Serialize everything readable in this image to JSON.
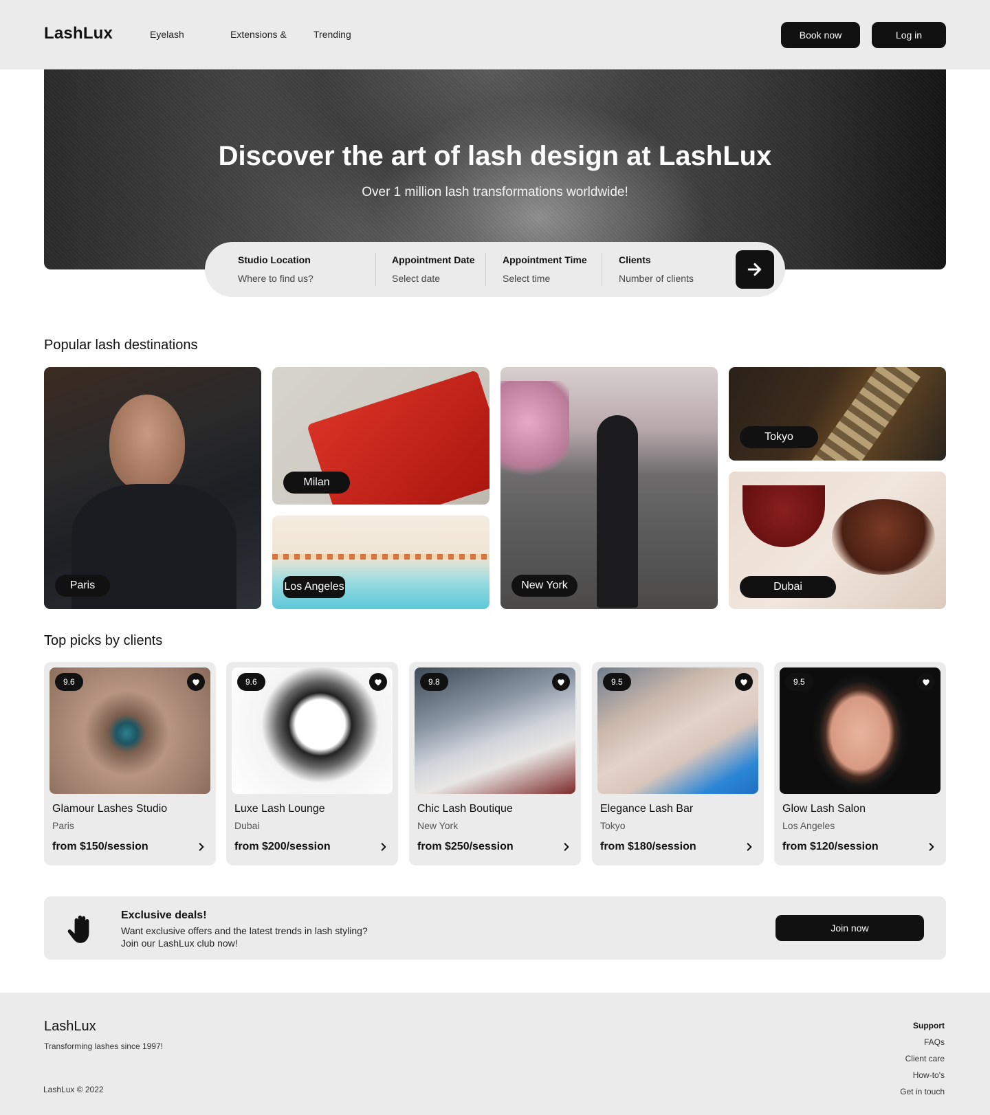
{
  "header": {
    "logo": "LashLux",
    "nav": [
      "Eyelash",
      "Extensions &",
      "Trending"
    ],
    "book_label": "Book now",
    "login_label": "Log in"
  },
  "hero": {
    "title": "Discover the art of lash design at LashLux",
    "subtitle": "Over 1 million lash transformations worldwide!"
  },
  "search": {
    "fields": [
      {
        "label": "Studio Location",
        "placeholder": "Where to find us?"
      },
      {
        "label": "Appointment Date",
        "placeholder": "Select date"
      },
      {
        "label": "Appointment Time",
        "placeholder": "Select time"
      },
      {
        "label": "Clients",
        "placeholder": "Number of clients"
      }
    ],
    "submit_icon": "arrow-right-icon"
  },
  "destinations": {
    "title": "Popular lash destinations",
    "items": [
      {
        "city": "Paris"
      },
      {
        "city": "Milan"
      },
      {
        "city": "Los Angeles"
      },
      {
        "city": "New York"
      },
      {
        "city": "Tokyo"
      },
      {
        "city": "Dubai"
      }
    ]
  },
  "top_picks": {
    "title": "Top picks by clients",
    "items": [
      {
        "score": "9.6",
        "name": "Glamour Lashes Studio",
        "city": "Paris",
        "price": "from $150/session"
      },
      {
        "score": "9.6",
        "name": "Luxe Lash Lounge",
        "city": "Dubai",
        "price": "from $200/session"
      },
      {
        "score": "9.8",
        "name": "Chic Lash Boutique",
        "city": "New York",
        "price": "from $250/session"
      },
      {
        "score": "9.5",
        "name": "Elegance Lash Bar",
        "city": "Tokyo",
        "price": "from $180/session"
      },
      {
        "score": "9.5",
        "name": "Glow Lash Salon",
        "city": "Los Angeles",
        "price": "from $120/session"
      }
    ]
  },
  "promo": {
    "icon": "hand-icon",
    "title": "Exclusive deals!",
    "line1": "Want exclusive offers and the latest trends in lash styling?",
    "line2": "Join our LashLux club now!",
    "cta": "Join now"
  },
  "footer": {
    "logo": "LashLux",
    "tagline": "Transforming lashes since 1997!",
    "copyright": "LashLux © 2022",
    "support_title": "Support",
    "links": [
      "FAQs",
      "Client care",
      "How-to's",
      "Get in touch"
    ]
  },
  "colors": {
    "accent": "#111111",
    "surface": "#ebebeb",
    "background": "#ffffff"
  }
}
